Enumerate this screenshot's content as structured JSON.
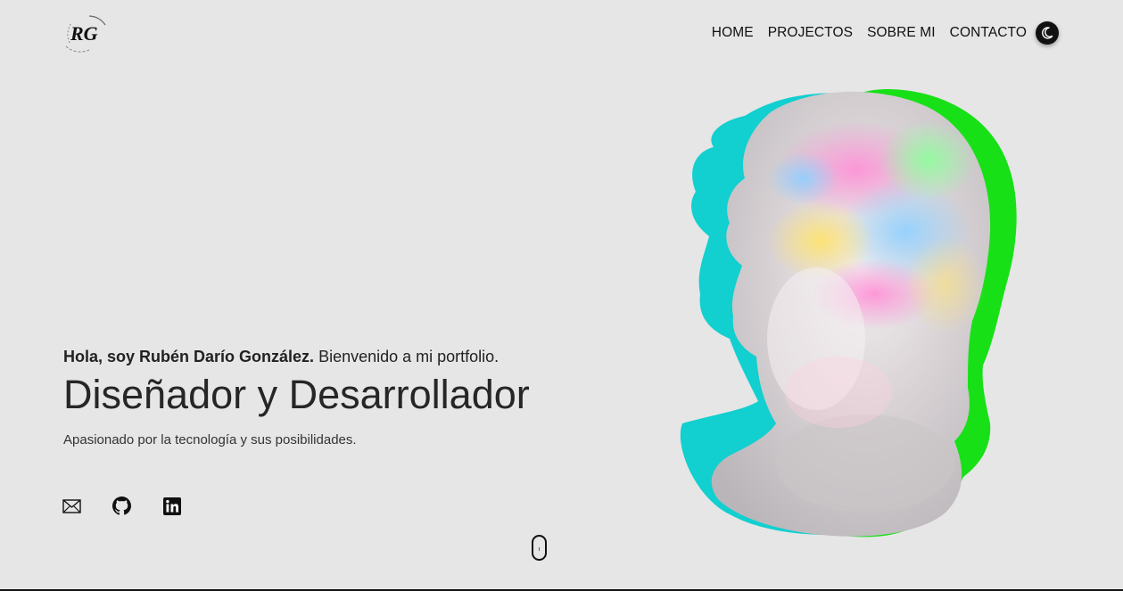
{
  "logo": {
    "monogram": "RG"
  },
  "nav": {
    "items": [
      "HOME",
      "PROJECTOS",
      "SOBRE MI",
      "CONTACTO"
    ],
    "theme_toggle_icon": "moon-icon"
  },
  "hero": {
    "greeting_name": "Hola, soy Rubén Darío González.",
    "greeting_rest": " Bienvenido a mi portfolio.",
    "headline": "Diseñador y Desarrollador",
    "subline": "Apasionado por la tecnología y sus posibilidades."
  },
  "socials": [
    "mail-icon",
    "github-icon",
    "linkedin-icon"
  ],
  "colors": {
    "background": "#e6e6e6",
    "text": "#1f1f1f",
    "accent_cyan": "#00d0d0",
    "accent_green": "#10e010"
  }
}
